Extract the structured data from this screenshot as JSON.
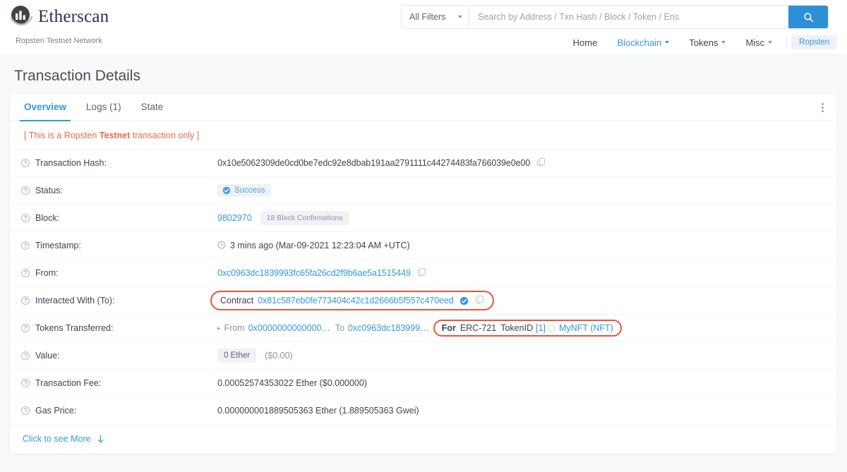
{
  "header": {
    "brand_name": "Etherscan",
    "logo_icon": "etherscan-logo-icon",
    "network_label": "Ropsten Testnet Network",
    "search": {
      "filter_label": "All Filters",
      "placeholder": "Search by Address / Txn Hash / Block / Token / Ens",
      "value": "",
      "search_icon": "search-icon"
    },
    "nav": [
      {
        "label": "Home",
        "has_caret": false,
        "active": false
      },
      {
        "label": "Blockchain",
        "has_caret": true,
        "active": true
      },
      {
        "label": "Tokens",
        "has_caret": true,
        "active": false
      },
      {
        "label": "Misc",
        "has_caret": true,
        "active": false
      }
    ],
    "network_pill": "Ropsten"
  },
  "page": {
    "title": "Transaction Details",
    "tabs": [
      {
        "label": "Overview",
        "active": true
      },
      {
        "label": "Logs (1)",
        "active": false
      },
      {
        "label": "State",
        "active": false
      }
    ],
    "kebab_icon": "more-options-icon",
    "testnet_note": {
      "prefix": "[ This is a Ropsten ",
      "strong": "Testnet",
      "suffix": " transaction only ]"
    }
  },
  "details": {
    "transaction_hash": {
      "label": "Transaction Hash:",
      "value": "0x10e5062309de0cd0be7edc92e8dbab191aa2791111c44274483fa766039e0e00",
      "copy_icon": "copy-icon"
    },
    "status": {
      "label": "Status:",
      "value": "Success",
      "check_icon": "check-circle-icon"
    },
    "block": {
      "label": "Block:",
      "number": "9802970",
      "confirmations": "18 Block Confirmations"
    },
    "timestamp": {
      "label": "Timestamp:",
      "clock_icon": "clock-icon",
      "value": "3 mins ago (Mar-09-2021 12:23:04 AM +UTC)"
    },
    "from": {
      "label": "From:",
      "address": "0xc0963dc1839993fc65fa26cd2f9b6ae5a1515449",
      "copy_icon": "copy-icon"
    },
    "interacted_with": {
      "label": "Interacted With (To):",
      "prefix": "Contract",
      "address": "0x81c587eb0fe773404c42c1d2666b5f557c470eed",
      "verified_icon": "verified-check-icon",
      "copy_icon": "copy-icon",
      "highlighted": true
    },
    "tokens_transferred": {
      "label": "Tokens Transferred:",
      "caret_icon": "chevron-right-icon",
      "from_label": "From",
      "from_address": "0x0000000000000…",
      "to_label": "To",
      "to_address": "0xc0963dc183999…",
      "for_label": "For",
      "token_standard": "ERC-721",
      "tokenid_label": "TokenID",
      "tokenid_value": "[1]",
      "token_icon": "nft-token-icon",
      "token_name": "MyNFT (NFT)",
      "highlighted": true
    },
    "value": {
      "label": "Value:",
      "amount": "0 Ether",
      "usd": "($0.00)"
    },
    "transaction_fee": {
      "label": "Transaction Fee:",
      "value": "0.00052574353022 Ether ($0.000000)"
    },
    "gas_price": {
      "label": "Gas Price:",
      "value": "0.000000001889505363 Ether (1.889505363 Gwei)"
    },
    "see_more": {
      "label": "Click to see More",
      "arrow_icon": "arrow-down-icon"
    }
  },
  "colors": {
    "link": "#3498db",
    "accent": "#2d8fd5",
    "annotation": "#e8553a",
    "testnet_text": "#e8694a",
    "page_bg": "#f8f9fa"
  }
}
